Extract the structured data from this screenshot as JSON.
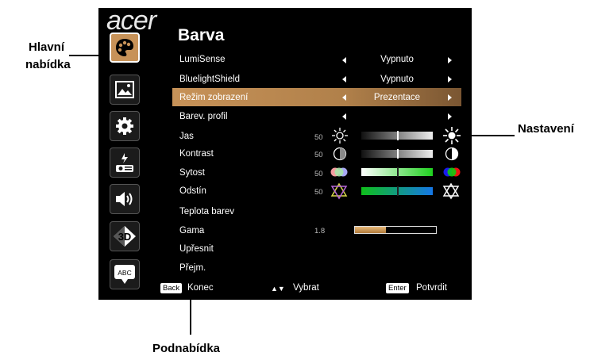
{
  "logo": "acer",
  "title": "Barva",
  "rows": [
    {
      "label": "LumiSense",
      "value": "Vypnuto"
    },
    {
      "label": "BluelightShield",
      "value": "Vypnuto"
    },
    {
      "label": "Režim zobrazení",
      "value": "Prezentace"
    },
    {
      "label": "Barev. profil",
      "value": ""
    },
    {
      "label": "Jas",
      "num": "50"
    },
    {
      "label": "Kontrast",
      "num": "50"
    },
    {
      "label": "Sytost",
      "num": "50"
    },
    {
      "label": "Odstín",
      "num": "50"
    },
    {
      "label": "Teplota barev"
    },
    {
      "label": "Gama",
      "num": "1.8"
    },
    {
      "label": "Upřesnit"
    },
    {
      "label": "Přejm."
    }
  ],
  "selected_row": "Režim zobrazení",
  "gamma_fill": 0.38,
  "sidebar_icons": [
    "palette-icon",
    "image-icon",
    "gear-icon",
    "power-management-icon",
    "audio-icon",
    "3d-icon",
    "abc-language-icon"
  ],
  "footer": {
    "back_key": "Back",
    "back_label": "Konec",
    "select_arrows": "▲▼",
    "select_label": "Vybrat",
    "enter_key": "Enter",
    "enter_label": "Potvrdit"
  },
  "callouts": {
    "main_menu_line1": "Hlavní",
    "main_menu_line2": "nabídka",
    "settings": "Nastavení",
    "submenu": "Podnabídka"
  },
  "colors": {
    "accent": "#c79258",
    "background": "#000000"
  }
}
